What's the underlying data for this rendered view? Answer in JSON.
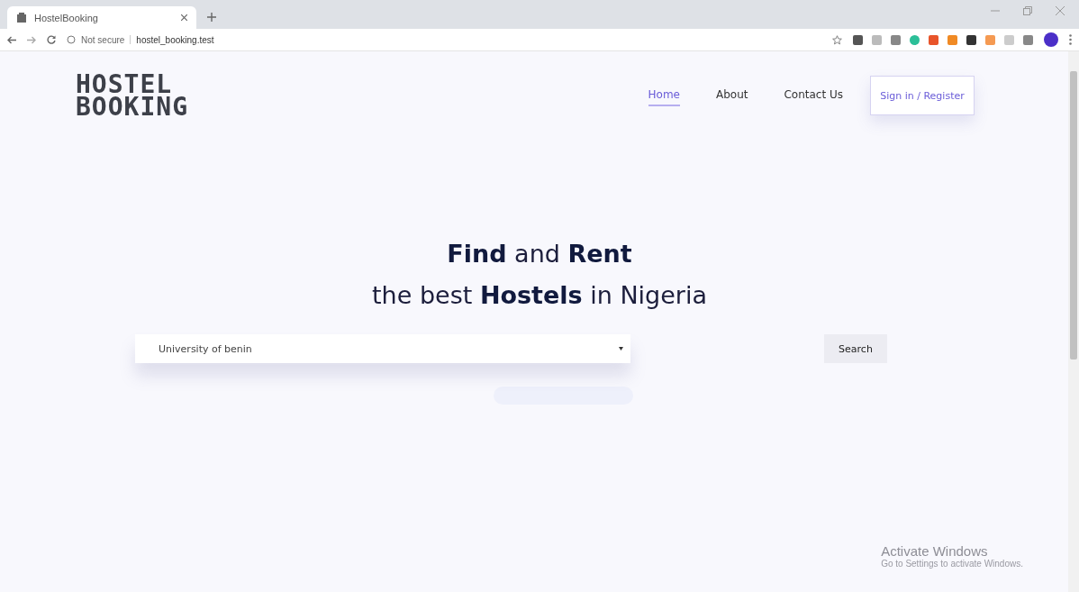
{
  "browser": {
    "tab_title": "HostelBooking",
    "security": "Not secure",
    "url": "hostel_booking.test"
  },
  "logo": [
    "HOSTEL",
    "BOOKING"
  ],
  "nav": [
    {
      "label": "Home",
      "selected": true
    },
    {
      "label": "About",
      "selected": false
    },
    {
      "label": "Contact Us",
      "selected": false
    }
  ],
  "sign_in_button": "Sign in / Register",
  "hero": {
    "headline": [
      "**Find** and **Rent**",
      "the best **Hostels** in Nigeria"
    ],
    "select_value": "University of benin",
    "search_button": "Search"
  },
  "os_notice": {
    "title": "Activate Windows",
    "message": "Go to Settings to activate Windows."
  }
}
